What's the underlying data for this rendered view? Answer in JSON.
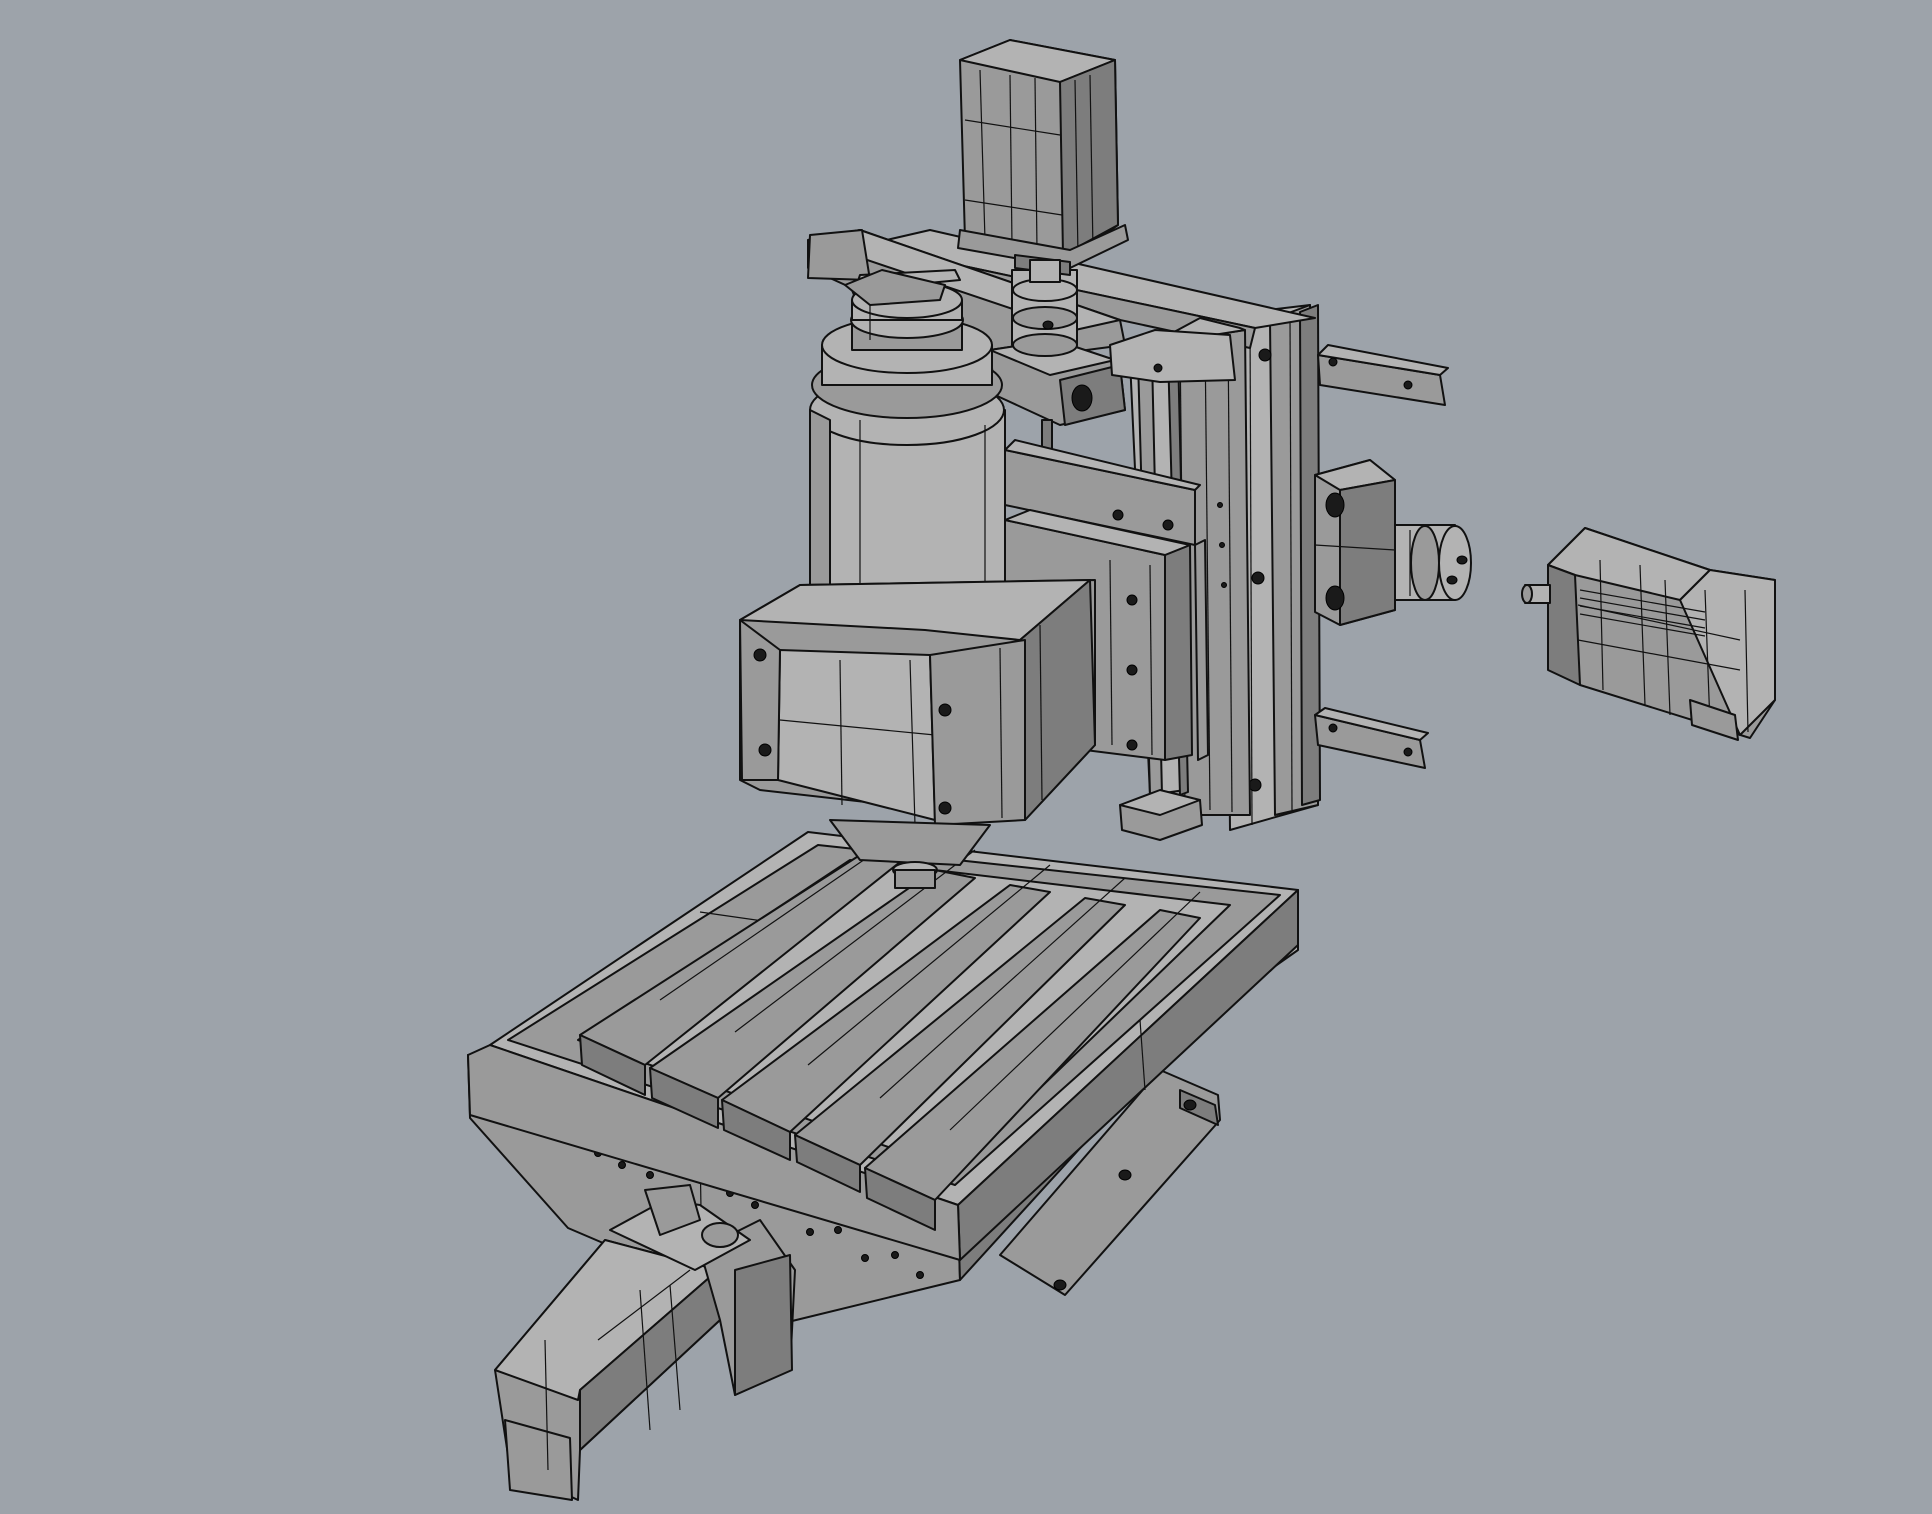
{
  "viewport": {
    "background": "#9da3aa",
    "display_mode": "shaded-wireframe",
    "face_light": "#b3b3b3",
    "face_mid": "#9a9a9a",
    "face_dark": "#7d7d7d",
    "face_darker": "#666666",
    "edge_color": "#111111"
  },
  "model": {
    "parts": [
      "z-axis-stepper-motor",
      "z-axis-coupling",
      "z-axis-bearing-block",
      "z-axis-column-plate",
      "z-axis-guide-rails",
      "spindle-motor",
      "spindle-clamp",
      "spindle-mount-plate",
      "y-axis-stepper-motor",
      "y-axis-coupling",
      "y-axis-bearing-block",
      "t-slot-work-table",
      "table-saddle",
      "base",
      "x-axis-stepper-motor",
      "x-axis-bearing-block"
    ]
  }
}
